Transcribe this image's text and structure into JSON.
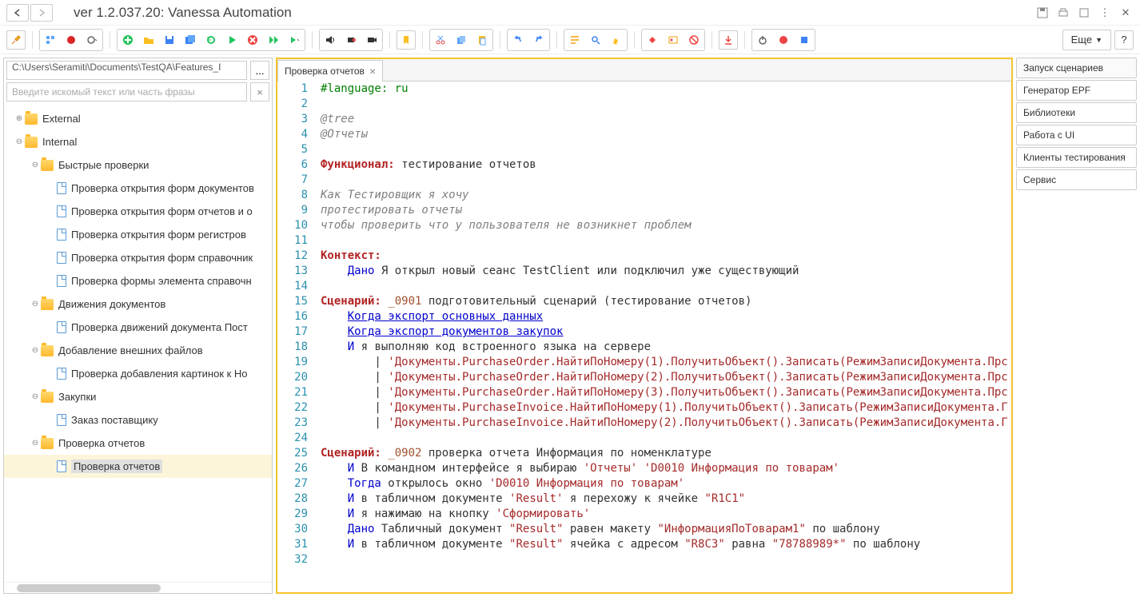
{
  "title": "ver 1.2.037.20: Vanessa Automation",
  "path_input": "C:\\Users\\Seramiti\\Documents\\TestQA\\Features_I",
  "search_placeholder": "Введите искомый текст или часть фразы",
  "path_btn": "...",
  "more_btn": "Еще",
  "tab_label": "Проверка отчетов",
  "tree": {
    "external": "External",
    "internal": "Internal",
    "fast": "Быстрые проверки",
    "f1": "Проверка открытия форм документов",
    "f2": "Проверка открытия форм отчетов и о",
    "f3": "Проверка открытия форм регистров",
    "f4": "Проверка открытия форм справочник",
    "f5": "Проверка формы элемента справочн",
    "moves": "Движения документов",
    "m1": "Проверка движений документа Пост",
    "ext": "Добавление внешних файлов",
    "e1": "Проверка добавления картинок к Но",
    "zak": "Закупки",
    "z1": "Заказ поставщику",
    "rep": "Проверка отчетов",
    "r1": "Проверка отчетов"
  },
  "right": [
    "Запуск сценариев",
    "Генератор EPF",
    "Библиотеки",
    "Работа с UI",
    "Клиенты тестирования",
    "Сервис"
  ],
  "code": [
    {
      "n": 1,
      "h": "<span class='c-green'>#language: ru</span>"
    },
    {
      "n": 2,
      "h": ""
    },
    {
      "n": 3,
      "h": "<span class='c-grey'>@tree</span>"
    },
    {
      "n": 4,
      "h": "<span class='c-grey'>@Отчеты</span>"
    },
    {
      "n": 5,
      "h": ""
    },
    {
      "n": 6,
      "h": "<span class='c-red'>Функционал:</span> тестирование отчетов"
    },
    {
      "n": 7,
      "h": ""
    },
    {
      "n": 8,
      "h": "<span class='c-grey'>Как Тестировщик я хочу</span>"
    },
    {
      "n": 9,
      "h": "<span class='c-grey'>протестировать отчеты</span>"
    },
    {
      "n": 10,
      "h": "<span class='c-grey'>чтобы проверить что у пользователя не возникнет проблем</span>"
    },
    {
      "n": 11,
      "h": ""
    },
    {
      "n": 12,
      "h": "<span class='c-red'>Контекст:</span>"
    },
    {
      "n": 13,
      "h": "    <span class='c-blue'>Дано</span> Я открыл новый сеанс TestClient или подключил уже существующий"
    },
    {
      "n": 14,
      "h": ""
    },
    {
      "n": 15,
      "h": "<span class='c-red'>Сценарий:</span> <span class='c-orange'>_0901</span> подготовительный сценарий (тестирование отчетов)"
    },
    {
      "n": 16,
      "h": "    <span class='c-link'>Когда</span><span class='c-link'> экспорт основных данных</span>"
    },
    {
      "n": 17,
      "h": "    <span class='c-link'>Когда</span><span class='c-link'> экспорт документов закупок</span>"
    },
    {
      "n": 18,
      "h": "    <span class='c-blue'>И</span> я выполняю код встроенного языка на сервере"
    },
    {
      "n": 19,
      "h": "        | <span class='c-brown'>'Документы.PurchaseOrder.НайтиПоНомеру(1).ПолучитьОбъект().Записать(РежимЗаписиДокумента.Прс</span>"
    },
    {
      "n": 20,
      "h": "        | <span class='c-brown'>'Документы.PurchaseOrder.НайтиПоНомеру(2).ПолучитьОбъект().Записать(РежимЗаписиДокумента.Прс</span>"
    },
    {
      "n": 21,
      "h": "        | <span class='c-brown'>'Документы.PurchaseOrder.НайтиПоНомеру(3).ПолучитьОбъект().Записать(РежимЗаписиДокумента.Прс</span>"
    },
    {
      "n": 22,
      "h": "        | <span class='c-brown'>'Документы.PurchaseInvoice.НайтиПоНомеру(1).ПолучитьОбъект().Записать(РежимЗаписиДокумента.Г</span>"
    },
    {
      "n": 23,
      "h": "        | <span class='c-brown'>'Документы.PurchaseInvoice.НайтиПоНомеру(2).ПолучитьОбъект().Записать(РежимЗаписиДокумента.Г</span>"
    },
    {
      "n": 24,
      "h": ""
    },
    {
      "n": 25,
      "h": "<span class='c-red'>Сценарий:</span> <span class='c-orange'>_0902</span> проверка отчета Информация по номенклатуре"
    },
    {
      "n": 26,
      "h": "    <span class='c-blue'>И</span> В командном интерфейсе я выбираю <span class='c-brown'>'Отчеты'</span> <span class='c-brown'>'D0010 Информация по товарам'</span>"
    },
    {
      "n": 27,
      "h": "    <span class='c-blue'>Тогда</span> открылось окно <span class='c-brown'>'D0010 Информация по товарам'</span>"
    },
    {
      "n": 28,
      "h": "    <span class='c-blue'>И</span> в табличном документе <span class='c-brown'>'Result'</span> я перехожу к ячейке <span class='c-brown'>\"R1C1\"</span>"
    },
    {
      "n": 29,
      "h": "    <span class='c-blue'>И</span> я нажимаю на кнопку <span class='c-brown'>'Сформировать'</span>"
    },
    {
      "n": 30,
      "h": "    <span class='c-blue'>Дано</span> Табличный документ <span class='c-brown'>\"Result\"</span> равен макету <span class='c-brown'>\"ИнформацияПоТоварам1\"</span> по шаблону"
    },
    {
      "n": 31,
      "h": "    <span class='c-blue'>И</span> в табличном документе <span class='c-brown'>\"Result\"</span> ячейка с адресом <span class='c-brown'>\"R8C3\"</span> равна <span class='c-brown'>\"78788989*\"</span> по шаблону"
    },
    {
      "n": 32,
      "h": ""
    }
  ]
}
